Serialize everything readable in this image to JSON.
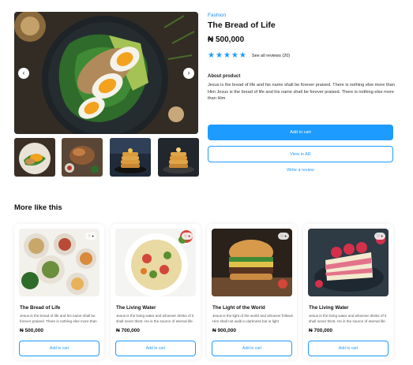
{
  "product": {
    "category": "Fashion",
    "title": "The Bread of Life",
    "price": "₦ 500,000",
    "rating": 5,
    "reviews_link": "See all reviews (20)",
    "about_label": "About product",
    "about_text": "Jesus is the bread of life and his name shall be forever praised. There is nothing else more than Him Jesus is the bread of life and his name shall be forever praised. There is nothing else more than Him",
    "add_to_cart": "Add to cart",
    "view_in_ar": "View in AR",
    "write_review": "Write a review"
  },
  "gallery": {
    "prev_icon": "chevron-left-icon",
    "next_icon": "chevron-right-icon",
    "prev_glyph": "‹",
    "next_glyph": "›"
  },
  "more_like_this": {
    "title": "More like this",
    "cards": [
      {
        "title": "The Bread of Life",
        "desc": "Jesus is the bread of life and his name shall be forever praised. There is nothing else more than Him",
        "price": "₦ 500,000",
        "badge": "♡ ●",
        "button": "Add to cart"
      },
      {
        "title": "The Living Water",
        "desc": "Jesus is the living water and whoever drinks of it shall never thirst. He is the source of eternal life",
        "price": "₦ 700,000",
        "badge": "♡ ●",
        "button": "Add to cart"
      },
      {
        "title": "The Light of the World",
        "desc": "Jesus is the light of the world and whoever follows Him shall not walk in darkness but in light",
        "price": "₦ 900,000",
        "badge": "♡ ●",
        "button": "Add to cart"
      },
      {
        "title": "The Living Water",
        "desc": "Jesus is the living water and whoever drinks of it shall never thirst. He is the source of eternal life",
        "price": "₦ 700,000",
        "badge": "♡ ●",
        "button": "Add to cart"
      }
    ]
  },
  "colors": {
    "accent": "#1e9bff",
    "text": "#111111",
    "category": "#1f8fe8"
  }
}
